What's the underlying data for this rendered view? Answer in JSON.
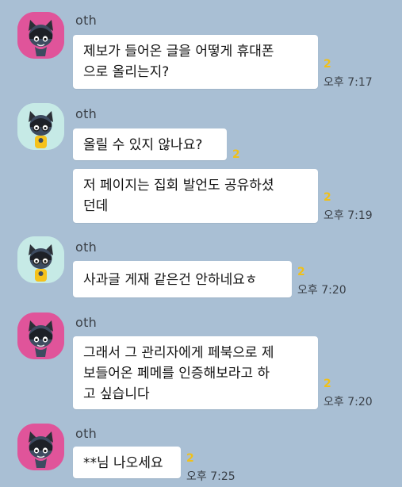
{
  "colors": {
    "background": "#a9bfd4",
    "bubble": "#ffffff",
    "unread": "#f0c018",
    "avatar_pink": "#e0549a",
    "avatar_mint": "#c6eae6"
  },
  "messages": [
    {
      "sender": "oth",
      "avatar": "pink-cat-avatar",
      "bubbles": [
        {
          "lines": [
            "제보가 들어온 글을 어떻게 휴대폰",
            "으로 올리는지?"
          ],
          "unread": "2",
          "time": "오후 7:17"
        }
      ]
    },
    {
      "sender": "oth",
      "avatar": "mint-cat-avatar",
      "bubbles": [
        {
          "lines": [
            "올릴 수 있지 않나요?"
          ],
          "unread": "2",
          "time": ""
        },
        {
          "lines": [
            "저 페이지는 집회 발언도 공유하셨",
            "던데"
          ],
          "unread": "2",
          "time": "오후 7:19"
        }
      ]
    },
    {
      "sender": "oth",
      "avatar": "mint-cat-avatar",
      "bubbles": [
        {
          "lines": [
            "사과글 게재 같은건 안하네요ㅎ"
          ],
          "unread": "2",
          "time": "오후 7:20"
        }
      ]
    },
    {
      "sender": "oth",
      "avatar": "pink-cat-avatar",
      "bubbles": [
        {
          "lines": [
            "그래서 그 관리자에게 페북으로 제",
            "보들어온 페메를 인증해보라고 하",
            "고 싶습니다"
          ],
          "unread": "2",
          "time": "오후 7:20"
        }
      ]
    },
    {
      "sender": "oth",
      "avatar": "pink-cat-avatar",
      "bubbles": [
        {
          "lines": [
            "**님 나오세요"
          ],
          "unread": "2",
          "time": "오후 7:25"
        }
      ]
    }
  ]
}
